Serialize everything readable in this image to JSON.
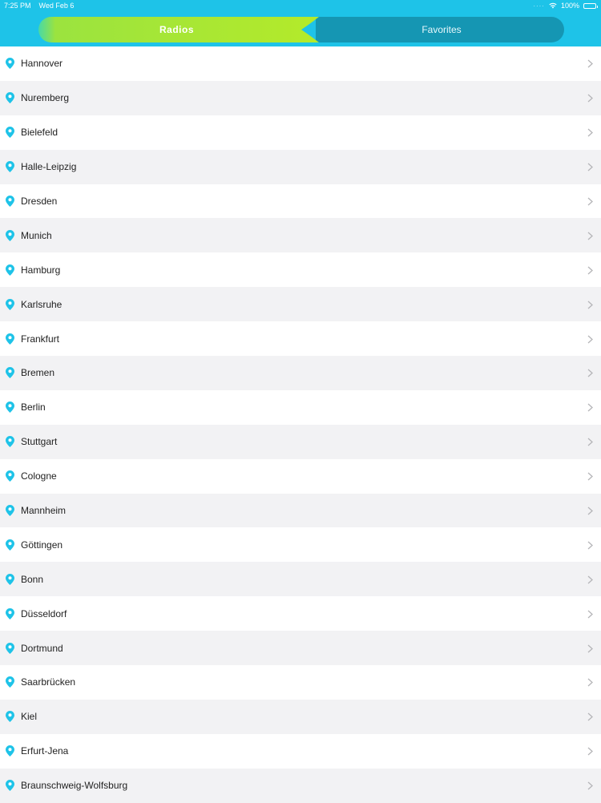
{
  "status_bar": {
    "time": "7:25 PM",
    "date": "Wed Feb 6",
    "battery": "100%"
  },
  "tabs": [
    {
      "label": "Radios",
      "active": true
    },
    {
      "label": "Favorites",
      "active": false
    }
  ],
  "colors": {
    "header": "#1ec3e8",
    "active_tab": "#a8e63a",
    "inactive_tab": "#1596b3",
    "pin": "#1ec3e8"
  },
  "cities": [
    {
      "label": "Hannover"
    },
    {
      "label": "Nuremberg"
    },
    {
      "label": "Bielefeld"
    },
    {
      "label": "Halle-Leipzig"
    },
    {
      "label": "Dresden"
    },
    {
      "label": "Munich"
    },
    {
      "label": "Hamburg"
    },
    {
      "label": "Karlsruhe"
    },
    {
      "label": "Frankfurt"
    },
    {
      "label": "Bremen"
    },
    {
      "label": "Berlin"
    },
    {
      "label": "Stuttgart"
    },
    {
      "label": "Cologne"
    },
    {
      "label": "Mannheim"
    },
    {
      "label": "Göttingen"
    },
    {
      "label": "Bonn"
    },
    {
      "label": "Düsseldorf"
    },
    {
      "label": "Dortmund"
    },
    {
      "label": "Saarbrücken"
    },
    {
      "label": "Kiel"
    },
    {
      "label": "Erfurt-Jena"
    },
    {
      "label": "Braunschweig-Wolfsburg"
    }
  ]
}
